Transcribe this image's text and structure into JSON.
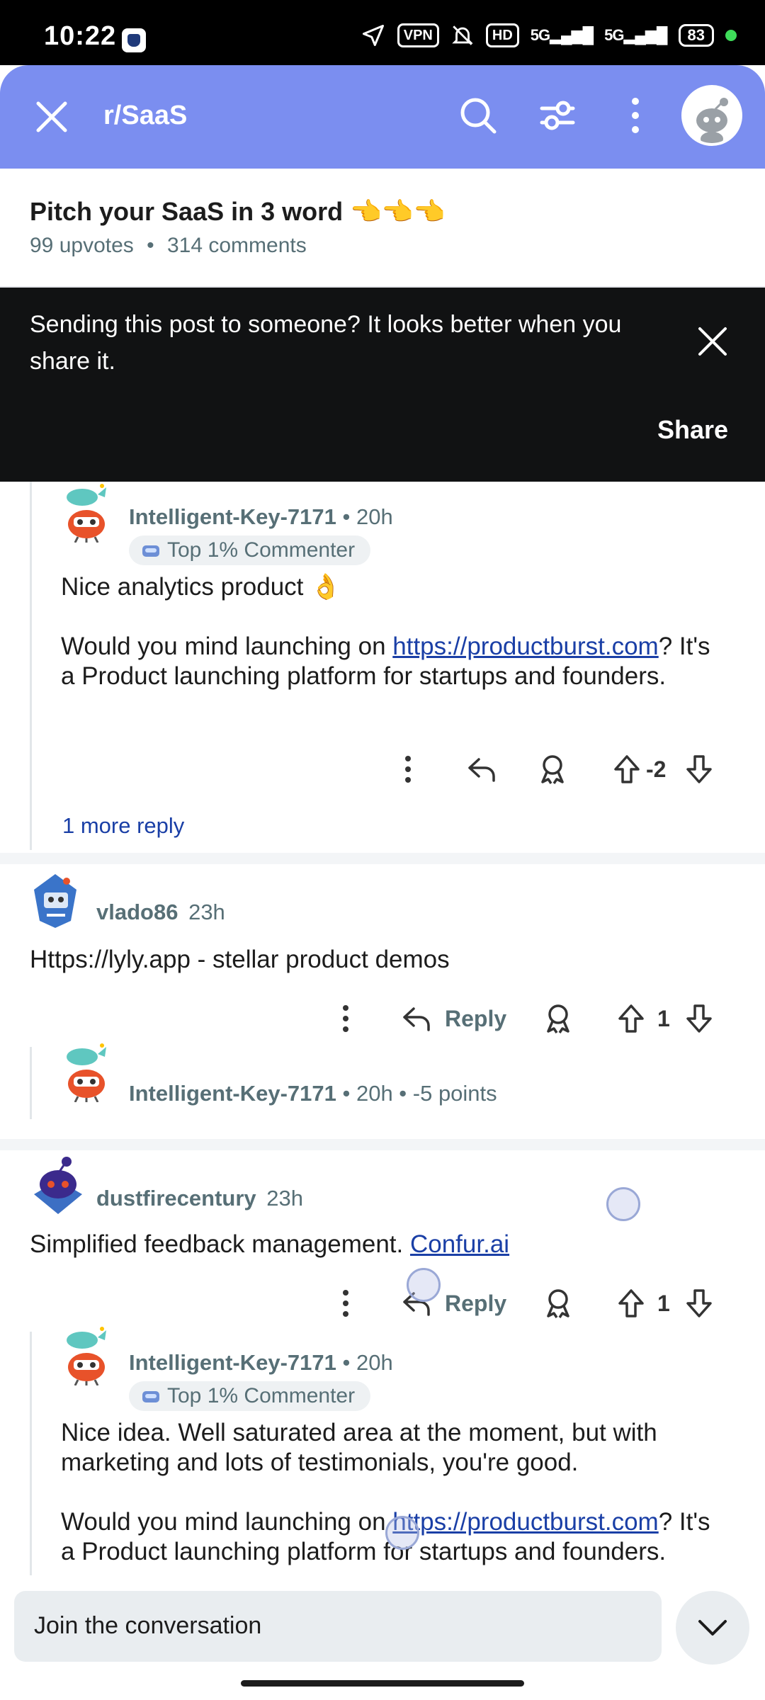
{
  "status_bar": {
    "time": "10:22",
    "vpn": "VPN",
    "hd": "HD",
    "net1": "5G",
    "net2": "5G",
    "battery": "83"
  },
  "app_bar": {
    "subreddit": "r/SaaS"
  },
  "post": {
    "title": "Pitch your SaaS in 3 word 👈👈👈",
    "upvotes": "99 upvotes",
    "dot": "•",
    "comments": "314 comments"
  },
  "share_banner": {
    "message": "Sending this post to someone? It looks better when you share it.",
    "share_label": "Share"
  },
  "comments": [
    {
      "author": "Intelligent-Key-7171",
      "age": "• 20h",
      "flair": "Top 1% Commenter",
      "body_line1": "Nice analytics product 👌",
      "body_pre": "Would you mind launching on ",
      "link": "https://productburst.com",
      "body_post": "? It's a Product launching platform for startups and founders.",
      "score": "-2",
      "more_replies": "1 more reply"
    },
    {
      "author": "vlado86",
      "age": "23h",
      "body": "Https://lyly.app - stellar product demos",
      "reply_label": "Reply",
      "score": "1",
      "child_author": "Intelligent-Key-7171",
      "child_meta": "• 20h • -5 points"
    },
    {
      "author": "dustfirecentury",
      "age": "23h",
      "body_pre": "Simplified feedback management. ",
      "link": "Confur.ai",
      "reply_label": "Reply",
      "score": "1"
    },
    {
      "author": "Intelligent-Key-7171",
      "age": "• 20h",
      "flair": "Top 1% Commenter",
      "body_line1": "Nice idea. Well saturated area at the moment, but with marketing and lots of testimonials, you're good.",
      "body_pre": "Would you mind launching on ",
      "link": "https://productburst.com",
      "body_post": "? It's a Product launching platform for startups and founders."
    }
  ],
  "composer": {
    "placeholder": "Join the conversation"
  }
}
